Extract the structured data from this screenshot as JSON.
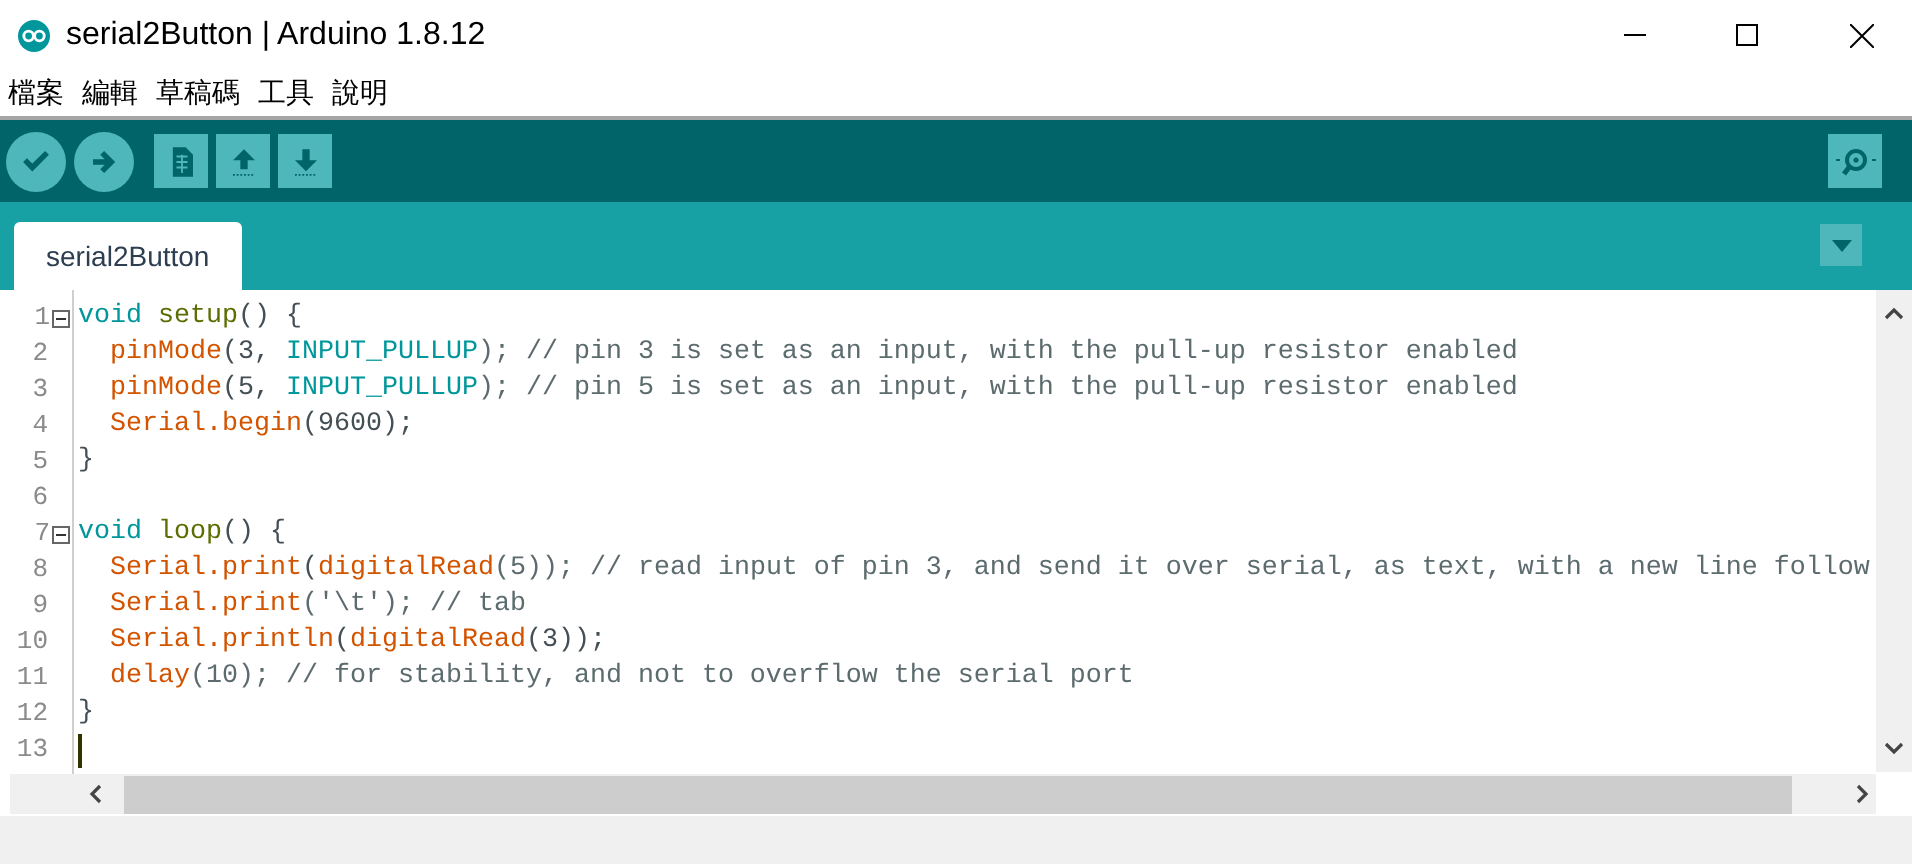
{
  "window": {
    "title": "serial2Button | Arduino 1.8.12"
  },
  "menu": [
    "檔案",
    "編輯",
    "草稿碼",
    "工具",
    "說明"
  ],
  "toolbar": [
    {
      "kind": "verify"
    },
    {
      "kind": "upload"
    },
    {
      "kind": "new"
    },
    {
      "kind": "open"
    },
    {
      "kind": "save"
    }
  ],
  "tabs": [
    {
      "label": "serial2Button",
      "selected": true
    }
  ],
  "editor": {
    "lines": [
      {
        "number": "1",
        "foldable": true,
        "cursor": false,
        "tokens": [
          {
            "text": "void",
            "kind": "keyword"
          },
          {
            "text": " setup",
            "kind": "function"
          },
          {
            "text": "() {",
            "kind": "plain"
          }
        ]
      },
      {
        "number": "2",
        "foldable": false,
        "cursor": false,
        "tokens": [
          {
            "text": "  pinMode",
            "kind": "builtin"
          },
          {
            "text": "(3, ",
            "kind": "plain"
          },
          {
            "text": "INPUT_PULLUP",
            "kind": "constant"
          },
          {
            "text": "); // pin 3 is set as an input, with the pull-up resistor enabled",
            "kind": "comment"
          }
        ]
      },
      {
        "number": "3",
        "foldable": false,
        "cursor": false,
        "tokens": [
          {
            "text": "  pinMode",
            "kind": "builtin"
          },
          {
            "text": "(5, ",
            "kind": "plain"
          },
          {
            "text": "INPUT_PULLUP",
            "kind": "constant"
          },
          {
            "text": "); // pin 5 is set as an input, with the pull-up resistor enabled",
            "kind": "comment"
          }
        ]
      },
      {
        "number": "4",
        "foldable": false,
        "cursor": false,
        "tokens": [
          {
            "text": "  Serial.begin",
            "kind": "builtin"
          },
          {
            "text": "(9600);",
            "kind": "plain"
          }
        ]
      },
      {
        "number": "5",
        "foldable": false,
        "cursor": false,
        "tokens": [
          {
            "text": "}",
            "kind": "plain"
          }
        ]
      },
      {
        "number": "6",
        "foldable": false,
        "cursor": false
      },
      {
        "number": "7",
        "foldable": true,
        "cursor": false,
        "tokens": [
          {
            "text": "void",
            "kind": "keyword"
          },
          {
            "text": " loop",
            "kind": "function"
          },
          {
            "text": "() {",
            "kind": "plain"
          }
        ]
      },
      {
        "number": "8",
        "foldable": false,
        "cursor": false,
        "tokens": [
          {
            "text": "  Serial.print",
            "kind": "builtin"
          },
          {
            "text": "(",
            "kind": "plain"
          },
          {
            "text": "digitalRead",
            "kind": "builtin"
          },
          {
            "text": "(5)); // read input of pin 3, and send it over serial, as text, with a new line follow",
            "kind": "comment"
          }
        ]
      },
      {
        "number": "9",
        "foldable": false,
        "cursor": false,
        "tokens": [
          {
            "text": "  Serial.print",
            "kind": "builtin"
          },
          {
            "text": "('\\t'); // tab",
            "kind": "comment"
          }
        ]
      },
      {
        "number": "10",
        "foldable": false,
        "cursor": false,
        "tokens": [
          {
            "text": "  Serial.println",
            "kind": "builtin"
          },
          {
            "text": "(",
            "kind": "plain"
          },
          {
            "text": "digitalRead",
            "kind": "builtin"
          },
          {
            "text": "(3));",
            "kind": "plain"
          }
        ]
      },
      {
        "number": "11",
        "foldable": false,
        "cursor": false,
        "tokens": [
          {
            "text": "  delay",
            "kind": "builtin"
          },
          {
            "text": "(10); // for stability, and not to overflow the serial port",
            "kind": "comment"
          }
        ]
      },
      {
        "number": "12",
        "foldable": false,
        "cursor": false,
        "tokens": [
          {
            "text": "}",
            "kind": "plain"
          }
        ]
      },
      {
        "number": "13",
        "foldable": false,
        "cursor": true
      }
    ]
  }
}
